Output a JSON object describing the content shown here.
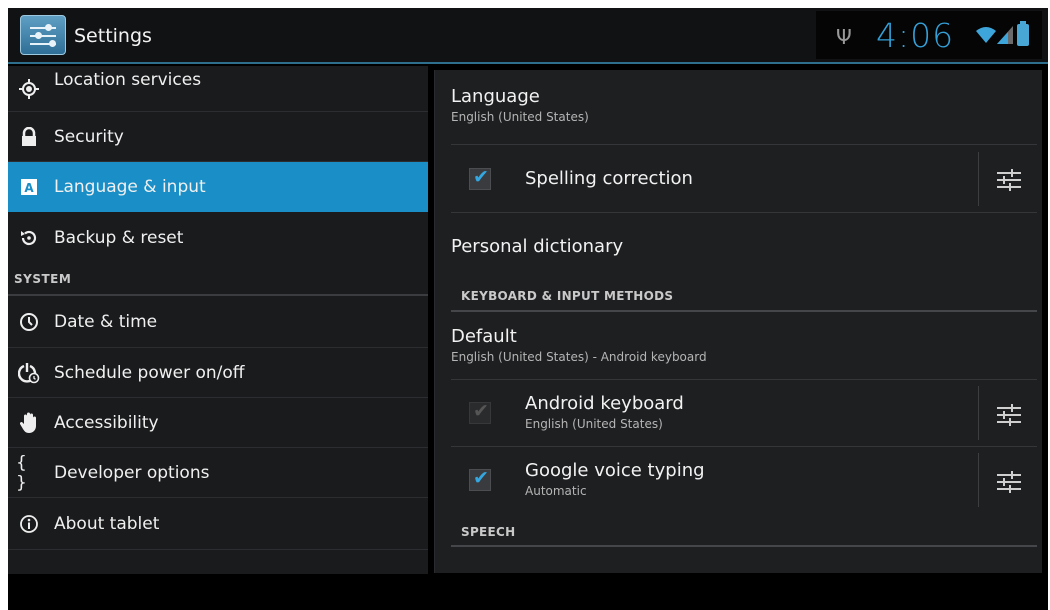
{
  "app": {
    "title": "Settings"
  },
  "status_bar": {
    "time": "4:06"
  },
  "sidebar": {
    "items": [
      {
        "label": "Location services"
      },
      {
        "label": "Security"
      },
      {
        "label": "Language & input"
      },
      {
        "label": "Backup & reset"
      }
    ],
    "system_header": "SYSTEM",
    "system_items": [
      {
        "label": "Date & time"
      },
      {
        "label": "Schedule power on/off"
      },
      {
        "label": "Accessibility"
      },
      {
        "label": "Developer options"
      },
      {
        "label": "About tablet"
      }
    ]
  },
  "detail": {
    "language": {
      "title": "Language",
      "summary": "English (United States)"
    },
    "spelling": {
      "title": "Spelling correction",
      "checked": true
    },
    "personal_dictionary": {
      "title": "Personal dictionary"
    },
    "keyboard_header": "KEYBOARD & INPUT METHODS",
    "default": {
      "title": "Default",
      "summary": "English (United States) - Android keyboard"
    },
    "android_keyboard": {
      "title": "Android keyboard",
      "summary": "English (United States)",
      "checked": true
    },
    "voice_typing": {
      "title": "Google voice typing",
      "summary": "Automatic",
      "checked": true
    },
    "speech_header": "SPEECH"
  },
  "colors": {
    "accent": "#1a8ec6",
    "check": "#34a7e0",
    "clock": "#34a0d8"
  }
}
